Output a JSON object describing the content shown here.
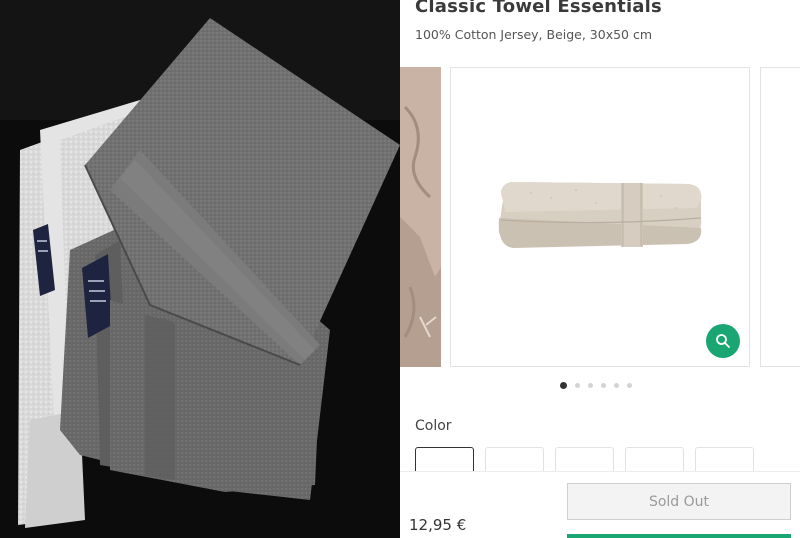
{
  "product": {
    "title": "Classic Towel Essentials",
    "subtitle": "100% Cotton Jersey, Beige, 30x50 cm",
    "price": "12,95 €"
  },
  "gallery": {
    "slide_count": 6,
    "active_slide": 1,
    "zoom_icon": "magnifier-icon"
  },
  "color_section": {
    "label": "Color",
    "swatch_count": 5,
    "selected_index": 0
  },
  "actions": {
    "sold_out_label": "Sold Out"
  },
  "colors": {
    "accent": "#1aa672",
    "towel_gray": "#6f6e6f",
    "towel_beige": "#d7cfc2"
  }
}
